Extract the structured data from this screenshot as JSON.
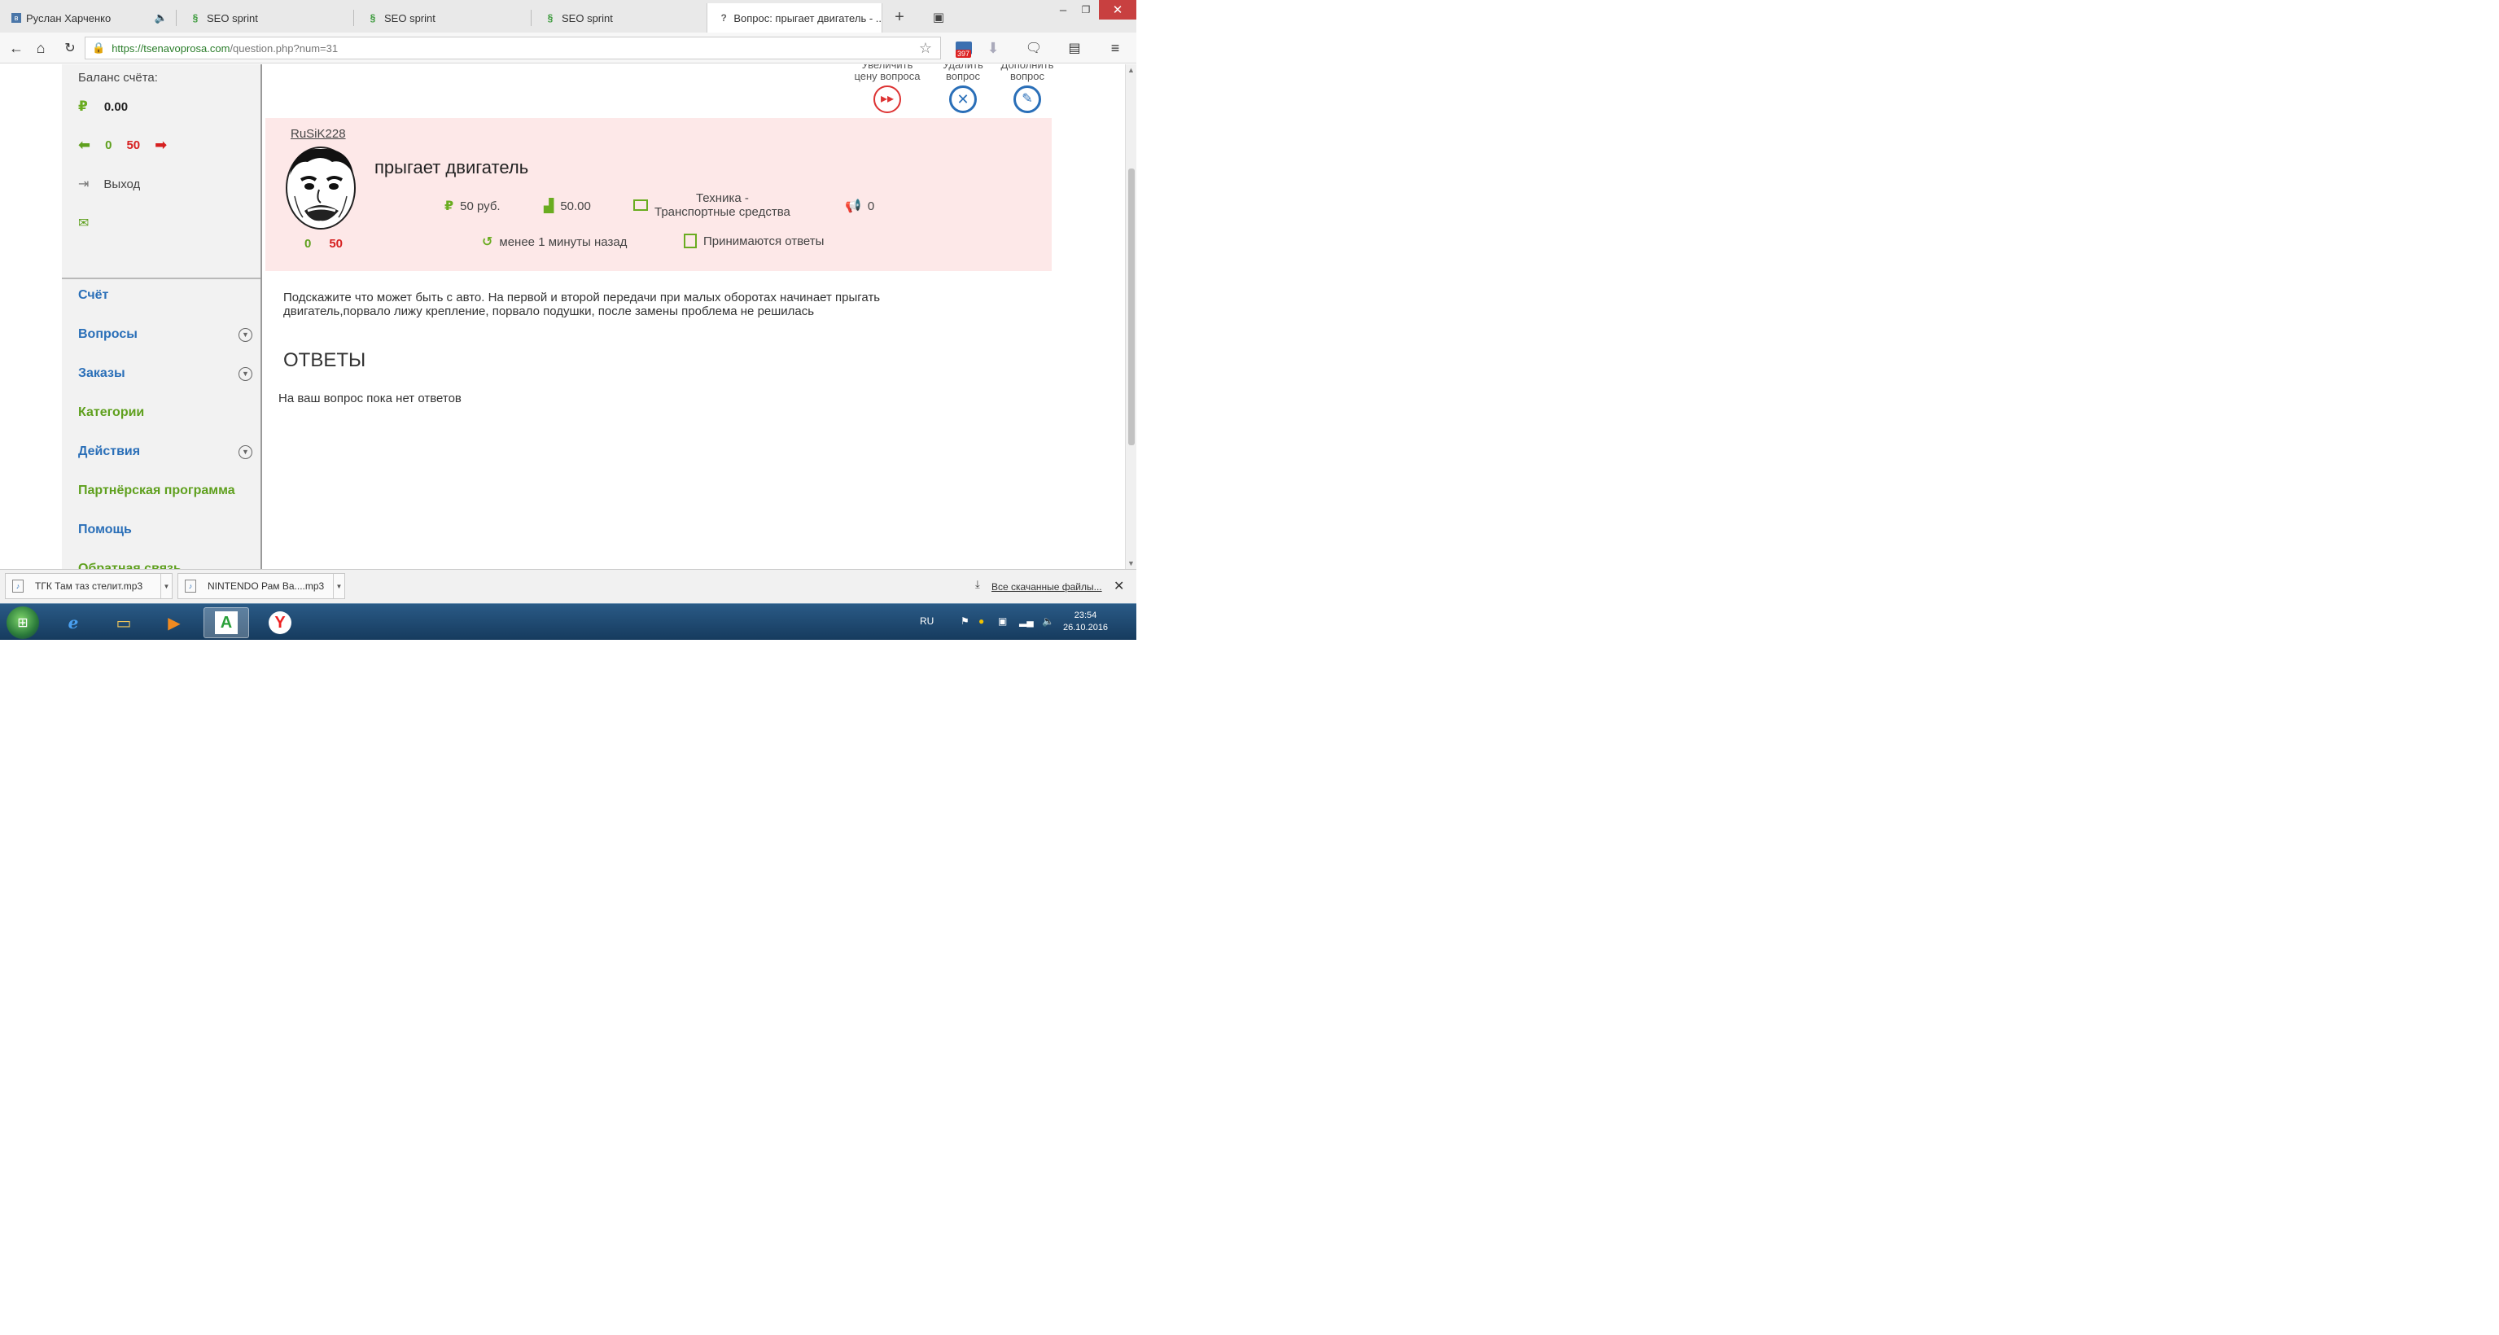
{
  "browser": {
    "tabs": [
      {
        "title": "Руслан Харченко",
        "icon": "vk-icon"
      },
      {
        "title": "SEO sprint",
        "icon": "seo-sprint-icon"
      },
      {
        "title": "SEO sprint",
        "icon": "seo-sprint-icon"
      },
      {
        "title": "SEO sprint",
        "icon": "seo-sprint-icon"
      },
      {
        "title": "Вопрос: прыгает двигатель - ..",
        "icon": "question-icon"
      }
    ],
    "url_host": "https://tsenavoprosa.com",
    "url_path": "/question.php?num=31",
    "mail_badge": "397"
  },
  "sidebar": {
    "balance_label": "Баланс счёта:",
    "balance_value": "0.00",
    "votes_plus": "0",
    "votes_minus": "50",
    "logout_label": "Выход",
    "menu": [
      {
        "label": "Счёт",
        "color": "#2a6fb8",
        "expandable": false
      },
      {
        "label": "Вопросы",
        "color": "#2a6fb8",
        "expandable": true
      },
      {
        "label": "Заказы",
        "color": "#2a6fb8",
        "expandable": true
      },
      {
        "label": "Категории",
        "color": "#5fa01e",
        "expandable": false
      },
      {
        "label": "Действия",
        "color": "#2a6fb8",
        "expandable": true
      },
      {
        "label": "Партнёрская программа",
        "color": "#5fa01e",
        "expandable": false
      },
      {
        "label": "Помощь",
        "color": "#2a6fb8",
        "expandable": false
      },
      {
        "label": "Обратная связь",
        "color": "#5fa01e",
        "expandable": false
      }
    ]
  },
  "actions": {
    "raise_price": {
      "line1": "Увеличить",
      "line2": "цену вопроса"
    },
    "delete": {
      "line1": "Удалить",
      "line2": "вопрос"
    },
    "add": {
      "line1": "Дополнить",
      "line2": "вопрос"
    }
  },
  "question": {
    "author": "RuSiK228",
    "author_votes_plus": "0",
    "author_votes_minus": "50",
    "title": "прыгает двигатель",
    "price": "50 руб.",
    "rating": "50.00",
    "category_line1": "Техника -",
    "category_line2": "Транспортные средства",
    "ads_count": "0",
    "time": "менее 1 минуты назад",
    "status": "Принимаются ответы",
    "text": "Подскажите что может быть с авто. На первой и второй передачи при малых оборотах начинает прыгать двигатель,порвало лижу крепление, порвало подушки, после замены проблема не решилась"
  },
  "answers": {
    "title": "ОТВЕТЫ",
    "empty": "На ваш вопрос пока нет ответов"
  },
  "downloads": {
    "items": [
      "ТГК Там таз стелит.mp3",
      "NINTENDO Рам Ва....mp3"
    ],
    "show_all": "Все скачанные файлы..."
  },
  "taskbar": {
    "lang": "RU",
    "time": "23:54",
    "date": "26.10.2016"
  }
}
